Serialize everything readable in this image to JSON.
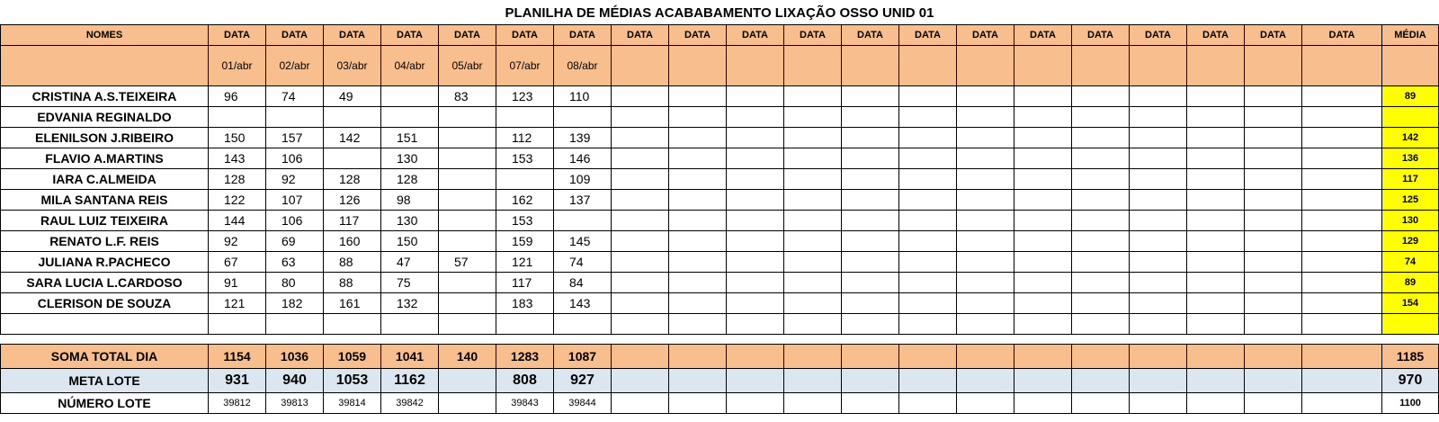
{
  "title": "PLANILHA DE MÉDIAS ACABABAMENTO LIXAÇÃO OSSO UNID 01",
  "header": {
    "names_label": "NOMES",
    "date_label": "DATA",
    "avg_label": "MÉDIA",
    "dates": [
      "01/abr",
      "02/abr",
      "03/abr",
      "04/abr",
      "05/abr",
      "07/abr",
      "08/abr",
      "",
      "",
      "",
      "",
      "",
      "",
      "",
      "",
      "",
      "",
      "",
      "",
      ""
    ]
  },
  "rows": [
    {
      "name": "CRISTINA A.S.TEIXEIRA",
      "values": [
        "96",
        "74",
        "49",
        "",
        "83",
        "123",
        "110"
      ],
      "avg": "89"
    },
    {
      "name": "EDVANIA REGINALDO",
      "values": [
        "",
        "",
        "",
        "",
        "",
        "",
        ""
      ],
      "avg": ""
    },
    {
      "name": "ELENILSON J.RIBEIRO",
      "values": [
        "150",
        "157",
        "142",
        "151",
        "",
        "112",
        "139"
      ],
      "avg": "142"
    },
    {
      "name": "FLAVIO A.MARTINS",
      "values": [
        "143",
        "106",
        "",
        "130",
        "",
        "153",
        "146"
      ],
      "avg": "136"
    },
    {
      "name": "IARA C.ALMEIDA",
      "values": [
        "128",
        "92",
        "128",
        "128",
        "",
        "",
        "109"
      ],
      "avg": "117"
    },
    {
      "name": "MILA SANTANA REIS",
      "values": [
        "122",
        "107",
        "126",
        "98",
        "",
        "162",
        "137"
      ],
      "avg": "125"
    },
    {
      "name": "RAUL LUIZ TEIXEIRA",
      "values": [
        "144",
        "106",
        "117",
        "130",
        "",
        "153",
        ""
      ],
      "avg": "130"
    },
    {
      "name": "RENATO L.F. REIS",
      "values": [
        "92",
        "69",
        "160",
        "150",
        "",
        "159",
        "145"
      ],
      "avg": "129"
    },
    {
      "name": "JULIANA R.PACHECO",
      "values": [
        "67",
        "63",
        "88",
        "47",
        "57",
        "121",
        "74"
      ],
      "avg": "74"
    },
    {
      "name": "SARA LUCIA L.CARDOSO",
      "values": [
        "91",
        "80",
        "88",
        "75",
        "",
        "117",
        "84"
      ],
      "avg": "89"
    },
    {
      "name": "CLERISON DE SOUZA",
      "values": [
        "121",
        "182",
        "161",
        "132",
        "",
        "183",
        "143"
      ],
      "avg": "154"
    },
    {
      "name": "",
      "values": [
        "",
        "",
        "",
        "",
        "",
        "",
        ""
      ],
      "avg": ""
    }
  ],
  "totals": {
    "soma": {
      "label": "SOMA TOTAL DIA",
      "values": [
        "1154",
        "1036",
        "1059",
        "1041",
        "140",
        "1283",
        "1087"
      ],
      "avg": "1185"
    },
    "meta": {
      "label": "META LOTE",
      "values": [
        "931",
        "940",
        "1053",
        "1162",
        "",
        "808",
        "927"
      ],
      "avg": "970"
    },
    "lote": {
      "label": "NÚMERO LOTE",
      "values": [
        "39812",
        "39813",
        "39814",
        "39842",
        "",
        "39843",
        "39844"
      ],
      "avg": "1100"
    }
  }
}
